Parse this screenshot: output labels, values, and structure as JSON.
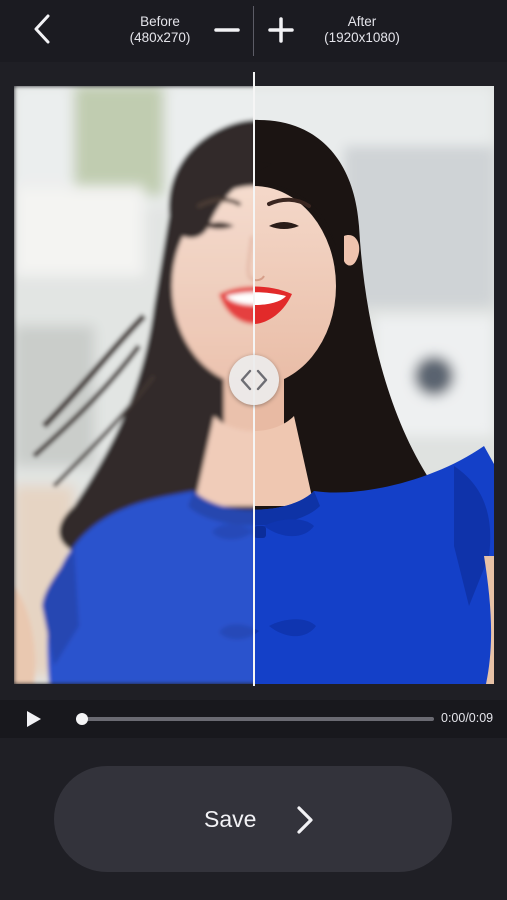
{
  "header": {
    "before_label": "Before",
    "before_resolution": "(480x270)",
    "after_label": "After",
    "after_resolution": "(1920x1080)",
    "back_icon": "chevron-left-icon",
    "zoom_out_icon": "minus-icon",
    "zoom_in_icon": "plus-icon"
  },
  "viewer": {
    "compare_handle_icon": "left-right-arrows-icon"
  },
  "player": {
    "play_icon": "play-icon",
    "time": "0:00/0:09",
    "progress": 0.0
  },
  "footer": {
    "save_label": "Save",
    "save_icon": "chevron-right-icon"
  },
  "colors": {
    "background": "#1f1f25",
    "topbar": "#1b1b21",
    "save_button": "#33333b",
    "dress_blue": "#1440c8"
  }
}
